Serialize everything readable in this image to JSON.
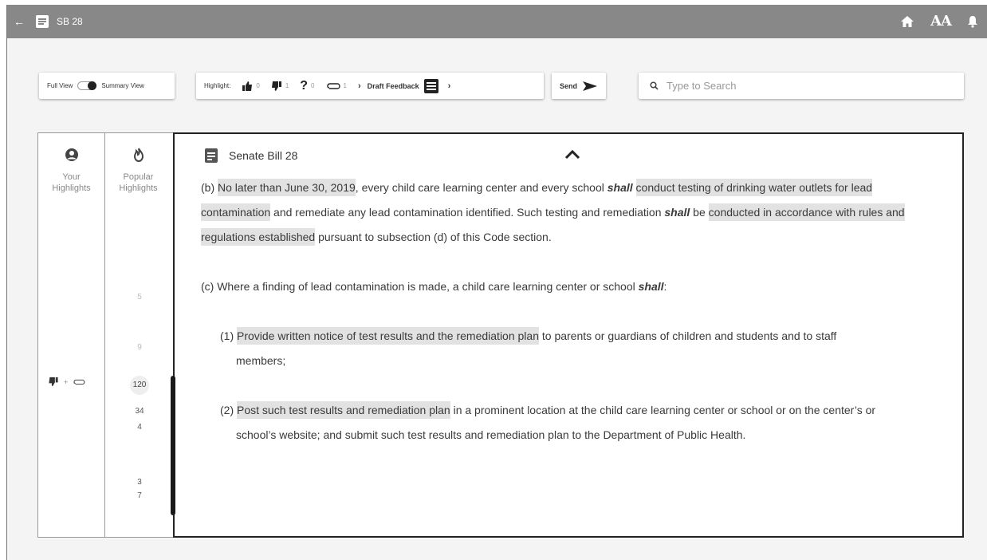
{
  "topbar": {
    "title": "SB 28",
    "aa_label": "AA"
  },
  "view_toggle": {
    "left_label": "Full View",
    "right_label": "Summary View"
  },
  "highlight_bar": {
    "label": "Highlight:",
    "thumbs_up_count": "0",
    "thumbs_down_count": "1",
    "question_count": "0",
    "attach_count": "1",
    "draft_label": "Draft Feedback"
  },
  "send": {
    "label": "Send"
  },
  "search": {
    "placeholder": "Type to Search"
  },
  "sidebar": {
    "your_label": "Your Highlights",
    "popular_label": "Popular Highlights",
    "popular_counts": [
      "5",
      "9",
      "120",
      "34",
      "4",
      "3",
      "7"
    ]
  },
  "document": {
    "title": "Senate Bill 28",
    "b_prefix": "(b) ",
    "b_hl1": "No later than June 30, 2019",
    "b_t1": ", every child care learning center and every school ",
    "b_shall1": "shall",
    "b_t2": " ",
    "b_hl2": "conduct testing of drinking water outlets for lead contamination",
    "b_t3": " and remediate any lead contamination identified. Such testing and remediation ",
    "b_shall2": "shall",
    "b_t4": " be ",
    "b_hl3": "conducted in accordance with rules and regulations established",
    "b_t5": " pursuant to subsection (d) of this Code section.",
    "c_t1": "(c) Where a finding of lead contamination is made, a child care learning center or school ",
    "c_shall": "shall",
    "c_t2": ":",
    "i1_prefix": "(1) ",
    "i1_hl": "Provide written notice of test results and the remediation plan",
    "i1_t": " to parents or guardians of children and students and to staff members;",
    "i2_prefix": "(2) ",
    "i2_hl": "Post such test results and remediation plan",
    "i2_t": " in a prominent location at the child care learning center or school or on the center’s or school’s website; and submit such test results and remediation plan to the Department of Public Health."
  }
}
